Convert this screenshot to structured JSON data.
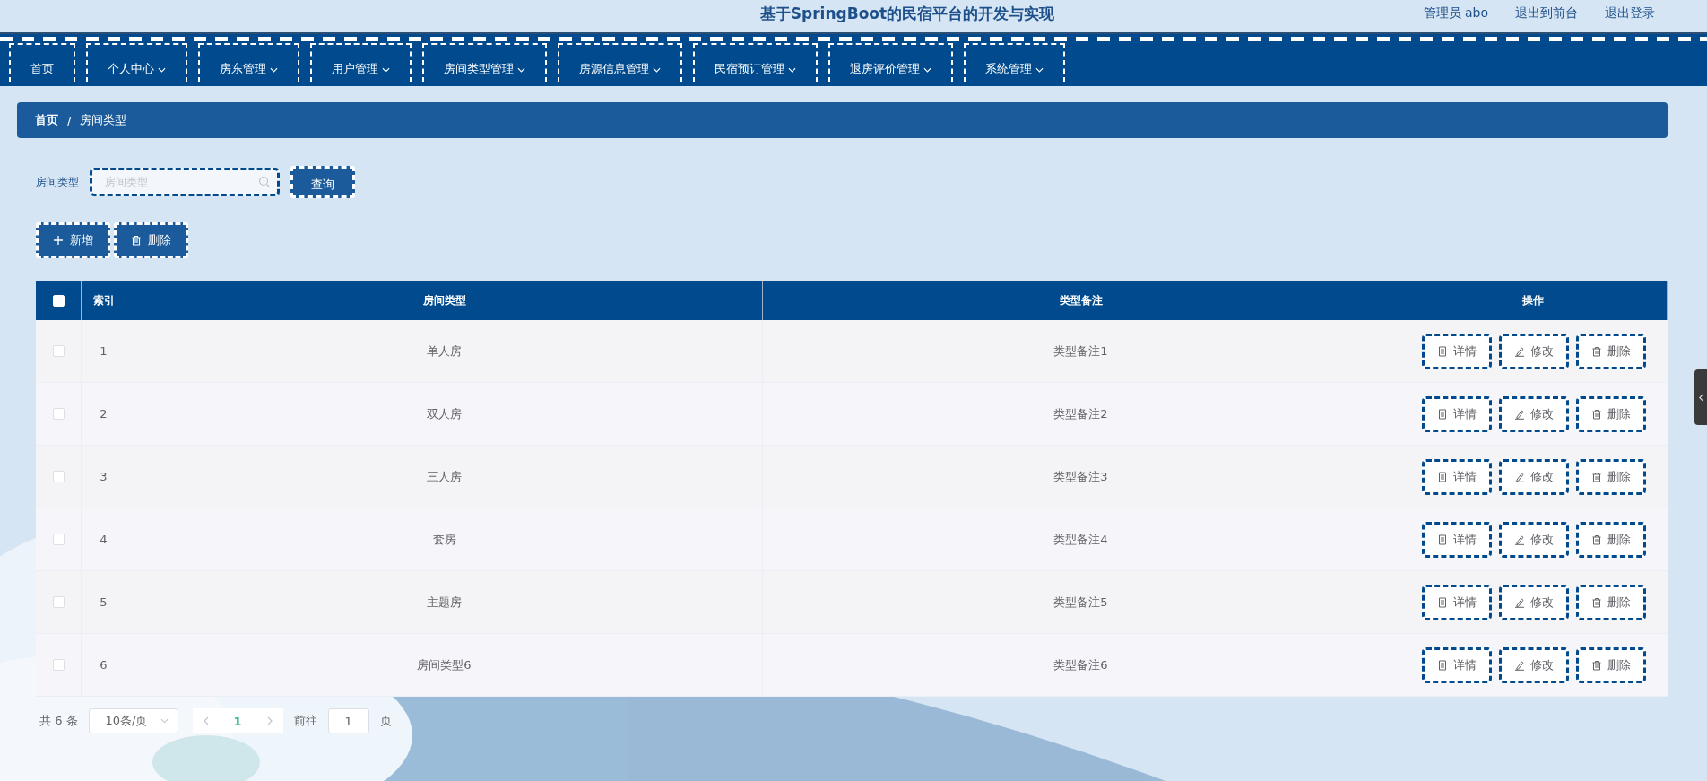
{
  "header": {
    "title": "基于SpringBoot的民宿平台的开发与实现",
    "links": [
      "管理员 abo",
      "退出到前台",
      "退出登录"
    ]
  },
  "nav": [
    {
      "label": "首页",
      "has_menu": false
    },
    {
      "label": "个人中心",
      "has_menu": true
    },
    {
      "label": "房东管理",
      "has_menu": true
    },
    {
      "label": "用户管理",
      "has_menu": true
    },
    {
      "label": "房间类型管理",
      "has_menu": true
    },
    {
      "label": "房源信息管理",
      "has_menu": true
    },
    {
      "label": "民宿预订管理",
      "has_menu": true
    },
    {
      "label": "退房评价管理",
      "has_menu": true
    },
    {
      "label": "系统管理",
      "has_menu": true
    }
  ],
  "breadcrumb": {
    "items": [
      "首页",
      "房间类型"
    ],
    "separator": "/"
  },
  "search": {
    "label": "房间类型",
    "placeholder": "房间类型",
    "button": "查询"
  },
  "toolbar": [
    {
      "kind": "add",
      "label": "新增"
    },
    {
      "kind": "delete",
      "label": "删除"
    }
  ],
  "table": {
    "header_checked": false,
    "columns": [
      "索引",
      "房间类型",
      "类型备注",
      "操作"
    ],
    "rows": [
      {
        "checked": false,
        "index": "1",
        "type": "单人房",
        "remark": "类型备注1",
        "actions": [
          {
            "kind": "detail",
            "label": "详情"
          },
          {
            "kind": "edit",
            "label": "修改"
          },
          {
            "kind": "delete",
            "label": "删除"
          }
        ]
      },
      {
        "checked": false,
        "index": "2",
        "type": "双人房",
        "remark": "类型备注2",
        "actions": [
          {
            "kind": "detail",
            "label": "详情"
          },
          {
            "kind": "edit",
            "label": "修改"
          },
          {
            "kind": "delete",
            "label": "删除"
          }
        ]
      },
      {
        "checked": false,
        "index": "3",
        "type": "三人房",
        "remark": "类型备注3",
        "actions": [
          {
            "kind": "detail",
            "label": "详情"
          },
          {
            "kind": "edit",
            "label": "修改"
          },
          {
            "kind": "delete",
            "label": "删除"
          }
        ]
      },
      {
        "checked": false,
        "index": "4",
        "type": "套房",
        "remark": "类型备注4",
        "actions": [
          {
            "kind": "detail",
            "label": "详情"
          },
          {
            "kind": "edit",
            "label": "修改"
          },
          {
            "kind": "delete",
            "label": "删除"
          }
        ]
      },
      {
        "checked": false,
        "index": "5",
        "type": "主题房",
        "remark": "类型备注5",
        "actions": [
          {
            "kind": "detail",
            "label": "详情"
          },
          {
            "kind": "edit",
            "label": "修改"
          },
          {
            "kind": "delete",
            "label": "删除"
          }
        ]
      },
      {
        "checked": false,
        "index": "6",
        "type": "房间类型6",
        "remark": "类型备注6",
        "actions": [
          {
            "kind": "detail",
            "label": "详情"
          },
          {
            "kind": "edit",
            "label": "修改"
          },
          {
            "kind": "delete",
            "label": "删除"
          }
        ]
      }
    ]
  },
  "pagination": {
    "total": "共 6 条",
    "page_size": "10条/页",
    "pages": [
      {
        "label": "1",
        "selected": true
      }
    ],
    "goto_label": "前往",
    "goto_value": "1",
    "goto_suffix": "页"
  }
}
